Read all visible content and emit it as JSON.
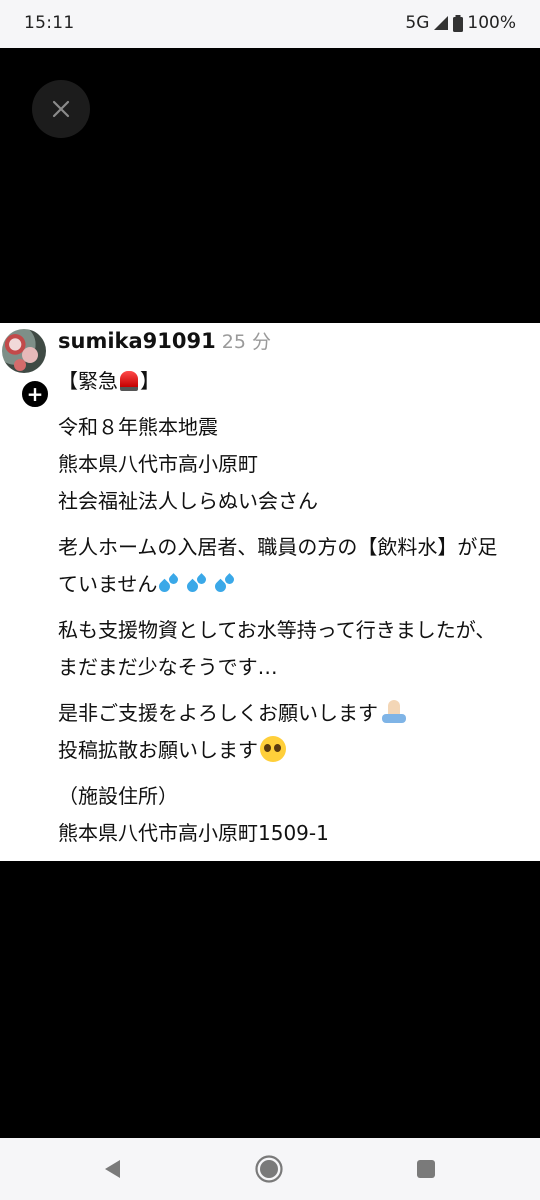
{
  "status_bar": {
    "time": "15:11",
    "network": "5G",
    "battery": "100%"
  },
  "icons": {
    "close": "close-icon",
    "follow": "plus-icon",
    "back": "back-triangle-icon",
    "home": "home-circle-icon",
    "recents": "recents-square-icon"
  },
  "post": {
    "username": "sumika91091",
    "time_ago": "25 分",
    "lines": {
      "l1a": "【緊急",
      "l1b": "】",
      "l2": "令和８年熊本地震",
      "l3": "熊本県八代市高小原町",
      "l4": "社会福祉法人しらぬい会さん",
      "l5": "老人ホームの入居者、職員の方の【飲料水】が足",
      "l6": "ていません",
      "l7": "私も支援物資としてお水等持って行きましたが、",
      "l8": "まだまだ少なそうです…",
      "l9": "是非ご支援をよろしくお願いします",
      "l10": "投稿拡散お願いします",
      "l11": "（施設住所）",
      "l12": "熊本県八代市高小原町1509-1"
    }
  }
}
